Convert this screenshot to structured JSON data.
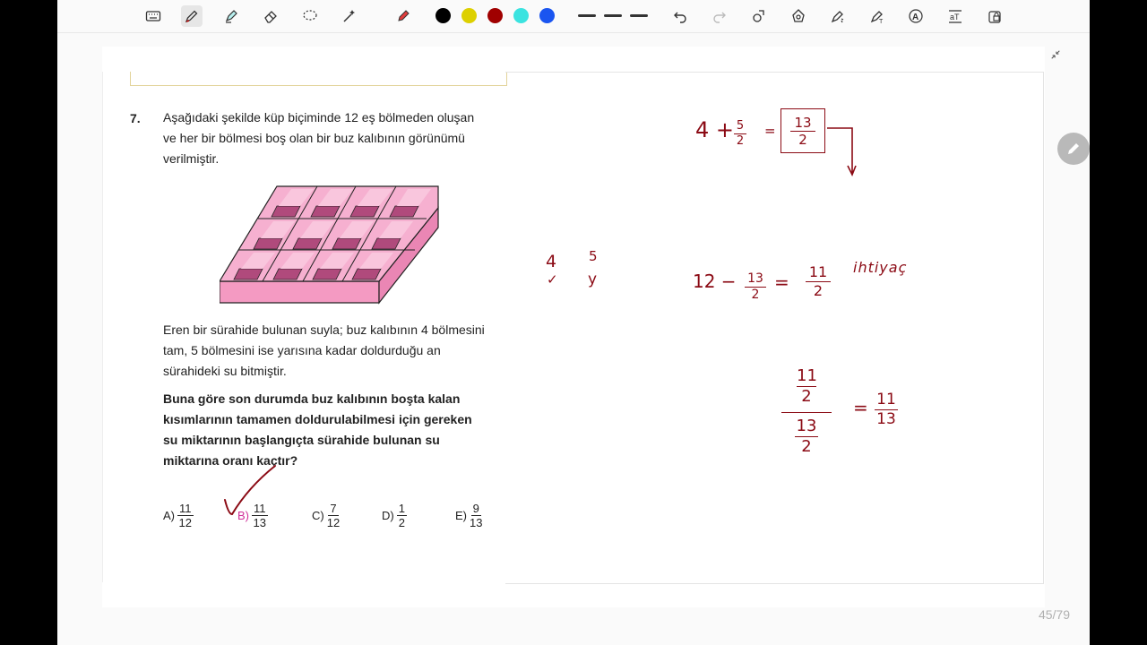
{
  "toolbar": {
    "tools": [
      "keyboard-icon",
      "pen-icon",
      "highlighter-icon",
      "eraser-icon",
      "lasso-icon",
      "magic-wand-icon",
      "marker-icon"
    ],
    "colors": [
      "#000000",
      "#ddd000",
      "#a00000",
      "#3be3e0",
      "#1a55f0"
    ],
    "actions": [
      "undo-icon",
      "redo-icon",
      "shapes-icon",
      "stamp-icon",
      "laser-icon",
      "text-tool-icon",
      "auto-text-icon",
      "text-recognition-icon",
      "lock-icon"
    ]
  },
  "question": {
    "number": "7.",
    "intro": [
      "Aşağıdaki şekilde küp biçiminde 12 eş bölmeden oluşan",
      "ve her bir bölmesi boş olan bir buz kalıbının görünümü",
      "verilmiştir."
    ],
    "body": [
      "Eren bir sürahide bulunan suyla; buz kalıbının 4 bölmesini",
      "tam, 5 bölmesini ise yarısına kadar doldurduğu an",
      "sürahideki su bitmiştir."
    ],
    "prompt": [
      "Buna göre son durumda buz kalıbının boşta kalan",
      "kısımlarının tamamen doldurulabilmesi için gereken",
      "su miktarının başlangıçta sürahide bulunan su",
      "miktarına oranı kaçtır?"
    ],
    "options": [
      {
        "label": "A)",
        "num": "11",
        "den": "12"
      },
      {
        "label": "B)",
        "num": "11",
        "den": "13"
      },
      {
        "label": "C)",
        "num": "7",
        "den": "12"
      },
      {
        "label": "D)",
        "num": "1",
        "den": "2"
      },
      {
        "label": "E)",
        "num": "9",
        "den": "13"
      }
    ]
  },
  "handwriting": {
    "eq1_left": "4 + ",
    "eq1_frac_num": "5",
    "eq1_frac_den": "2",
    "eq1_eq": "=",
    "eq1_box_num": "13",
    "eq1_box_den": "2",
    "side_a1": "4",
    "side_a2": "5",
    "side_b1": "✓",
    "side_b2": "y",
    "eq2_left": "12 − ",
    "eq2_frac_num": "13",
    "eq2_frac_den": "2",
    "eq2_eq": "=",
    "eq2_res_num": "11",
    "eq2_res_den": "2",
    "eq2_note": "ihtiyaç",
    "eq3_top_num": "11",
    "eq3_top_den": "2",
    "eq3_bot_num": "13",
    "eq3_bot_den": "2",
    "eq3_eq": "=",
    "eq3_res_num": "11",
    "eq3_res_den": "13"
  },
  "page_counter": "45/79",
  "colors": {
    "ink": "#8b0a14",
    "tray_pink": "#f4a7c9",
    "tray_dark": "#b04a7c"
  }
}
